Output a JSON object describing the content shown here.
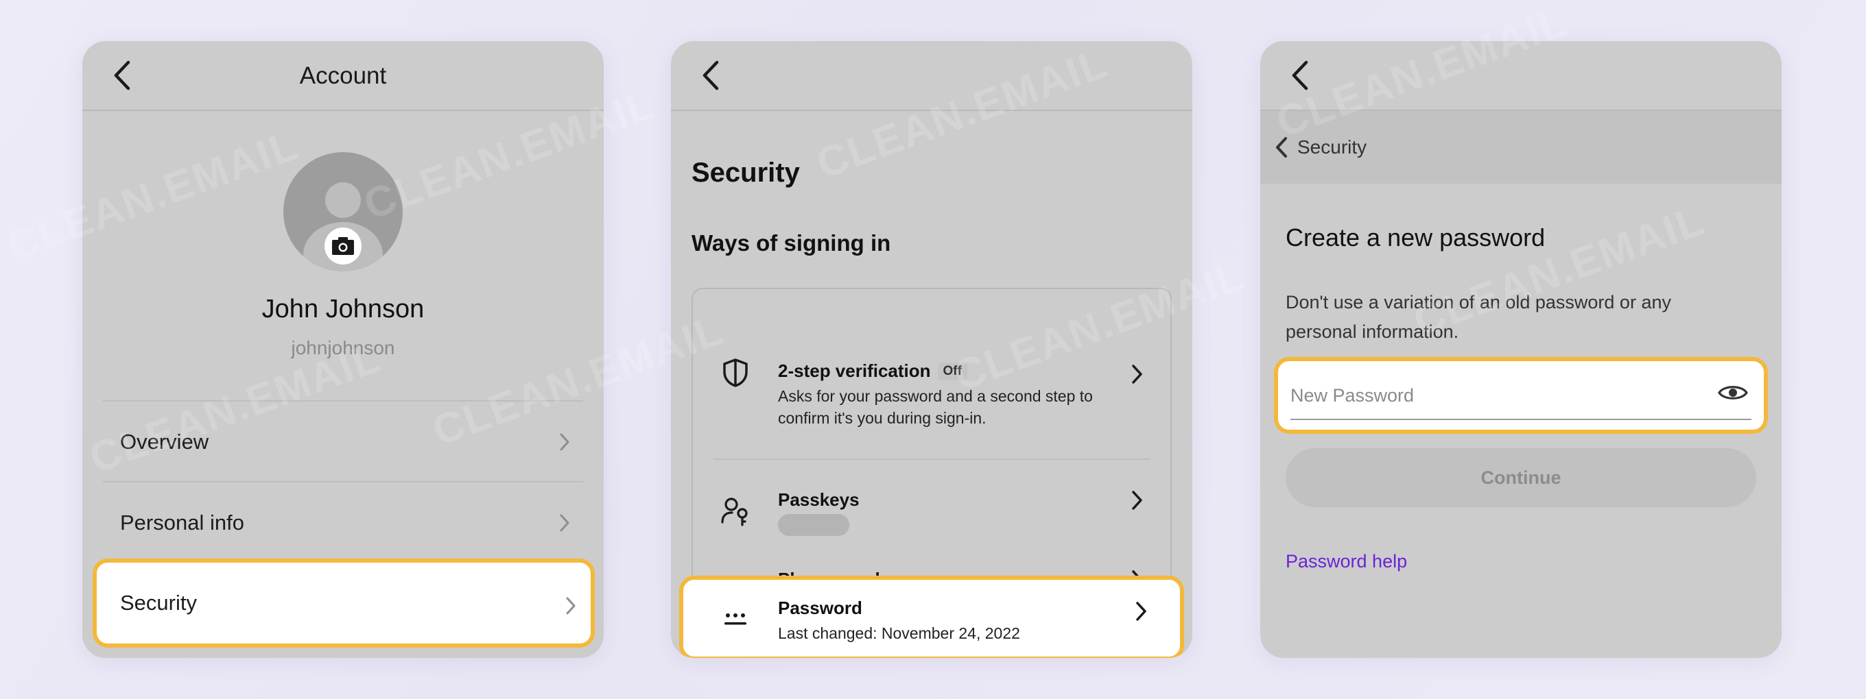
{
  "colors": {
    "highlight_border": "#f4b83a",
    "link": "#6b23d6",
    "panel_bg": "#cccccc"
  },
  "watermark": "CLEAN.EMAIL",
  "account": {
    "title": "Account",
    "back_icon": "chevron-left-icon",
    "avatar_icon": "user-avatar-icon",
    "camera_icon": "camera-icon",
    "name": "John Johnson",
    "username": "johnjohnson",
    "menu": [
      {
        "label": "Overview",
        "icon": "chevron-right-icon"
      },
      {
        "label": "Personal info",
        "icon": "chevron-right-icon"
      },
      {
        "label": "Security",
        "icon": "chevron-right-icon",
        "highlighted": true
      }
    ]
  },
  "security": {
    "back_icon": "chevron-left-icon",
    "title": "Security",
    "subtitle": "Ways of signing in",
    "rows": [
      {
        "title": "2-step verification",
        "badge": "Off",
        "description": "Asks for your password and a second step to confirm it's you during sign-in.",
        "icon": "shield-icon"
      },
      {
        "title": "Passkeys",
        "icon": "person-key-icon"
      },
      {
        "title": "Phone numbers",
        "icon": "phone-icon"
      },
      {
        "title": "Password",
        "description": "Last changed: November 24, 2022",
        "icon": "password-dots-icon",
        "highlighted": true
      }
    ]
  },
  "new_password": {
    "back_icon": "chevron-left-icon",
    "breadcrumb": "Security",
    "title": "Create a new password",
    "description": "Don't use a variation of an old password or any personal information.",
    "input_placeholder": "New Password",
    "input_value": "",
    "eye_icon": "eye-icon",
    "continue_label": "Continue",
    "help_link": "Password help"
  }
}
